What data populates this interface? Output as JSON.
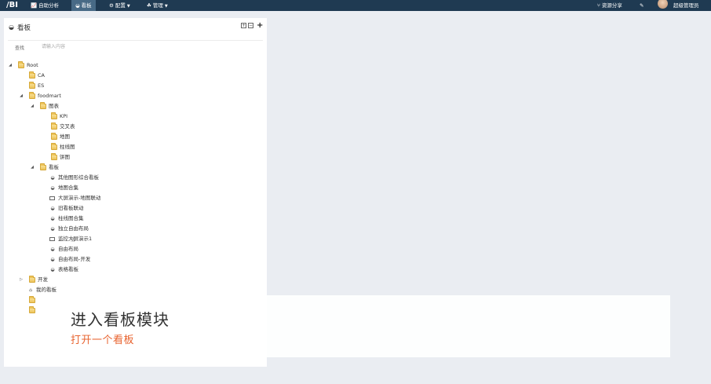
{
  "topbar": {
    "logo": "Cube-BI",
    "nav": [
      {
        "icon": "chart-icon",
        "label": "自助分析",
        "dropdown": false
      },
      {
        "icon": "dashboard-icon",
        "label": "看板",
        "dropdown": false
      },
      {
        "icon": "gears-icon",
        "label": "配置",
        "dropdown": true
      },
      {
        "icon": "users-icon",
        "label": "管理",
        "dropdown": true
      }
    ],
    "share_label": "资源分享",
    "user_name": "超级管理员"
  },
  "panel": {
    "title": "看板",
    "search_label": "查找",
    "search_placeholder": "请输入内容"
  },
  "tree": {
    "root": "Root",
    "ca": "CA",
    "es": "ES",
    "foodmart": "foodmart",
    "charts": "图表",
    "chart_items": [
      "KPI",
      "交叉表",
      "地图",
      "柱线图",
      "饼图"
    ],
    "boards": "看板",
    "board_items": [
      {
        "type": "dashboard",
        "label": "其他图形综合看板"
      },
      {
        "type": "dashboard",
        "label": "地图合集"
      },
      {
        "type": "screen",
        "label": "大屏演示-地图联动"
      },
      {
        "type": "dashboard",
        "label": "旧看板联动"
      },
      {
        "type": "dashboard",
        "label": "柱线图合集"
      },
      {
        "type": "dashboard",
        "label": "独立自由布局"
      },
      {
        "type": "screen",
        "label": "监控大屏演示1"
      },
      {
        "type": "dashboard",
        "label": "自由布局"
      },
      {
        "type": "dashboard",
        "label": "自由布局-开发"
      },
      {
        "type": "dashboard",
        "label": "表格看板"
      }
    ],
    "dev": "开发",
    "my_boards": "我的看板"
  },
  "caption": {
    "title": "进入看板模块",
    "subtitle": "打开一个看板"
  },
  "colors": {
    "topbar": "#1f3a52",
    "active_nav": "#486a86",
    "caption_sub": "#e8632f",
    "background": "#eaedf2"
  }
}
